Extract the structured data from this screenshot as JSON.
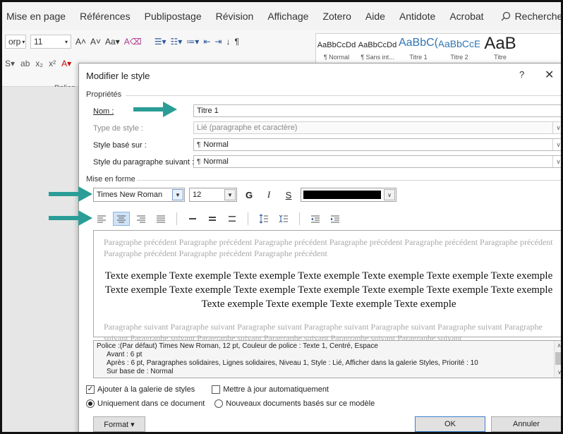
{
  "ribbon": {
    "tabs": [
      "Mise en page",
      "Références",
      "Publipostage",
      "Révision",
      "Affichage",
      "Zotero",
      "Aide",
      "Antidote",
      "Acrobat"
    ],
    "search_label": "Rechercher",
    "font_partial": "orp",
    "font_size": "11",
    "group_label": "Police",
    "styles": [
      {
        "preview": "AaBbCcDd",
        "name": "¶ Normal"
      },
      {
        "preview": "AaBbCcDd",
        "name": "¶ Sans int..."
      },
      {
        "preview": "AaBbC(",
        "name": "Titre 1"
      },
      {
        "preview": "AaBbCcE",
        "name": "Titre 2"
      },
      {
        "preview": "AaB",
        "name": "Titre"
      }
    ],
    "colors": {
      "accent": "#2b579a",
      "bg": "#f3f3f3"
    }
  },
  "dialog": {
    "title": "Modifier le style",
    "help": "?",
    "close": "✕",
    "properties": {
      "section": "Propriétés",
      "name_label": "Nom :",
      "name_value": "Titre 1",
      "type_label": "Type de style :",
      "type_value": "Lié (paragraphe et caractère)",
      "based_label": "Style basé sur :",
      "based_value": "Normal",
      "next_label": "Style du paragraphe suivant :",
      "next_value": "Normal"
    },
    "formatting": {
      "section": "Mise en forme",
      "font": "Times New Roman",
      "size": "12",
      "bold": "G",
      "italic": "I",
      "underline": "S",
      "color": "#000000"
    },
    "preview": {
      "previous": "Paragraphe précédent Paragraphe précédent Paragraphe précédent Paragraphe précédent Paragraphe précédent Paragraphe précédent Paragraphe précédent Paragraphe précédent Paragraphe précédent",
      "sample": "Texte exemple Texte exemple Texte exemple Texte exemple Texte exemple Texte exemple Texte exemple Texte exemple Texte exemple Texte exemple Texte exemple Texte exemple Texte exemple Texte exemple Texte exemple Texte exemple Texte exemple Texte exemple",
      "next": "Paragraphe suivant Paragraphe suivant Paragraphe suivant Paragraphe suivant Paragraphe suivant Paragraphe suivant Paragraphe suivant Paragraphe suivant Paragraphe suivant Paragraphe suivant Paragraphe suivant Paragraphe suivant"
    },
    "description": {
      "line1": "Police :(Par défaut) Times New Roman, 12 pt, Couleur de police : Texte 1, Centré, Espace",
      "line2": "Avant : 6 pt",
      "line3": "Après : 6 pt, Paragraphes solidaires, Lignes solidaires, Niveau 1, Style : Lié, Afficher dans la galerie Styles, Priorité : 10",
      "line4": "Sur base de : Normal"
    },
    "options": {
      "add_gallery": "Ajouter à la galerie de styles",
      "auto_update": "Mettre à jour automatiquement",
      "only_doc": "Uniquement dans ce document",
      "new_docs": "Nouveaux documents basés sur ce modèle"
    },
    "buttons": {
      "format": "Format ▾",
      "ok": "OK",
      "cancel": "Annuler"
    }
  },
  "annotation_color": "#2a9d96"
}
